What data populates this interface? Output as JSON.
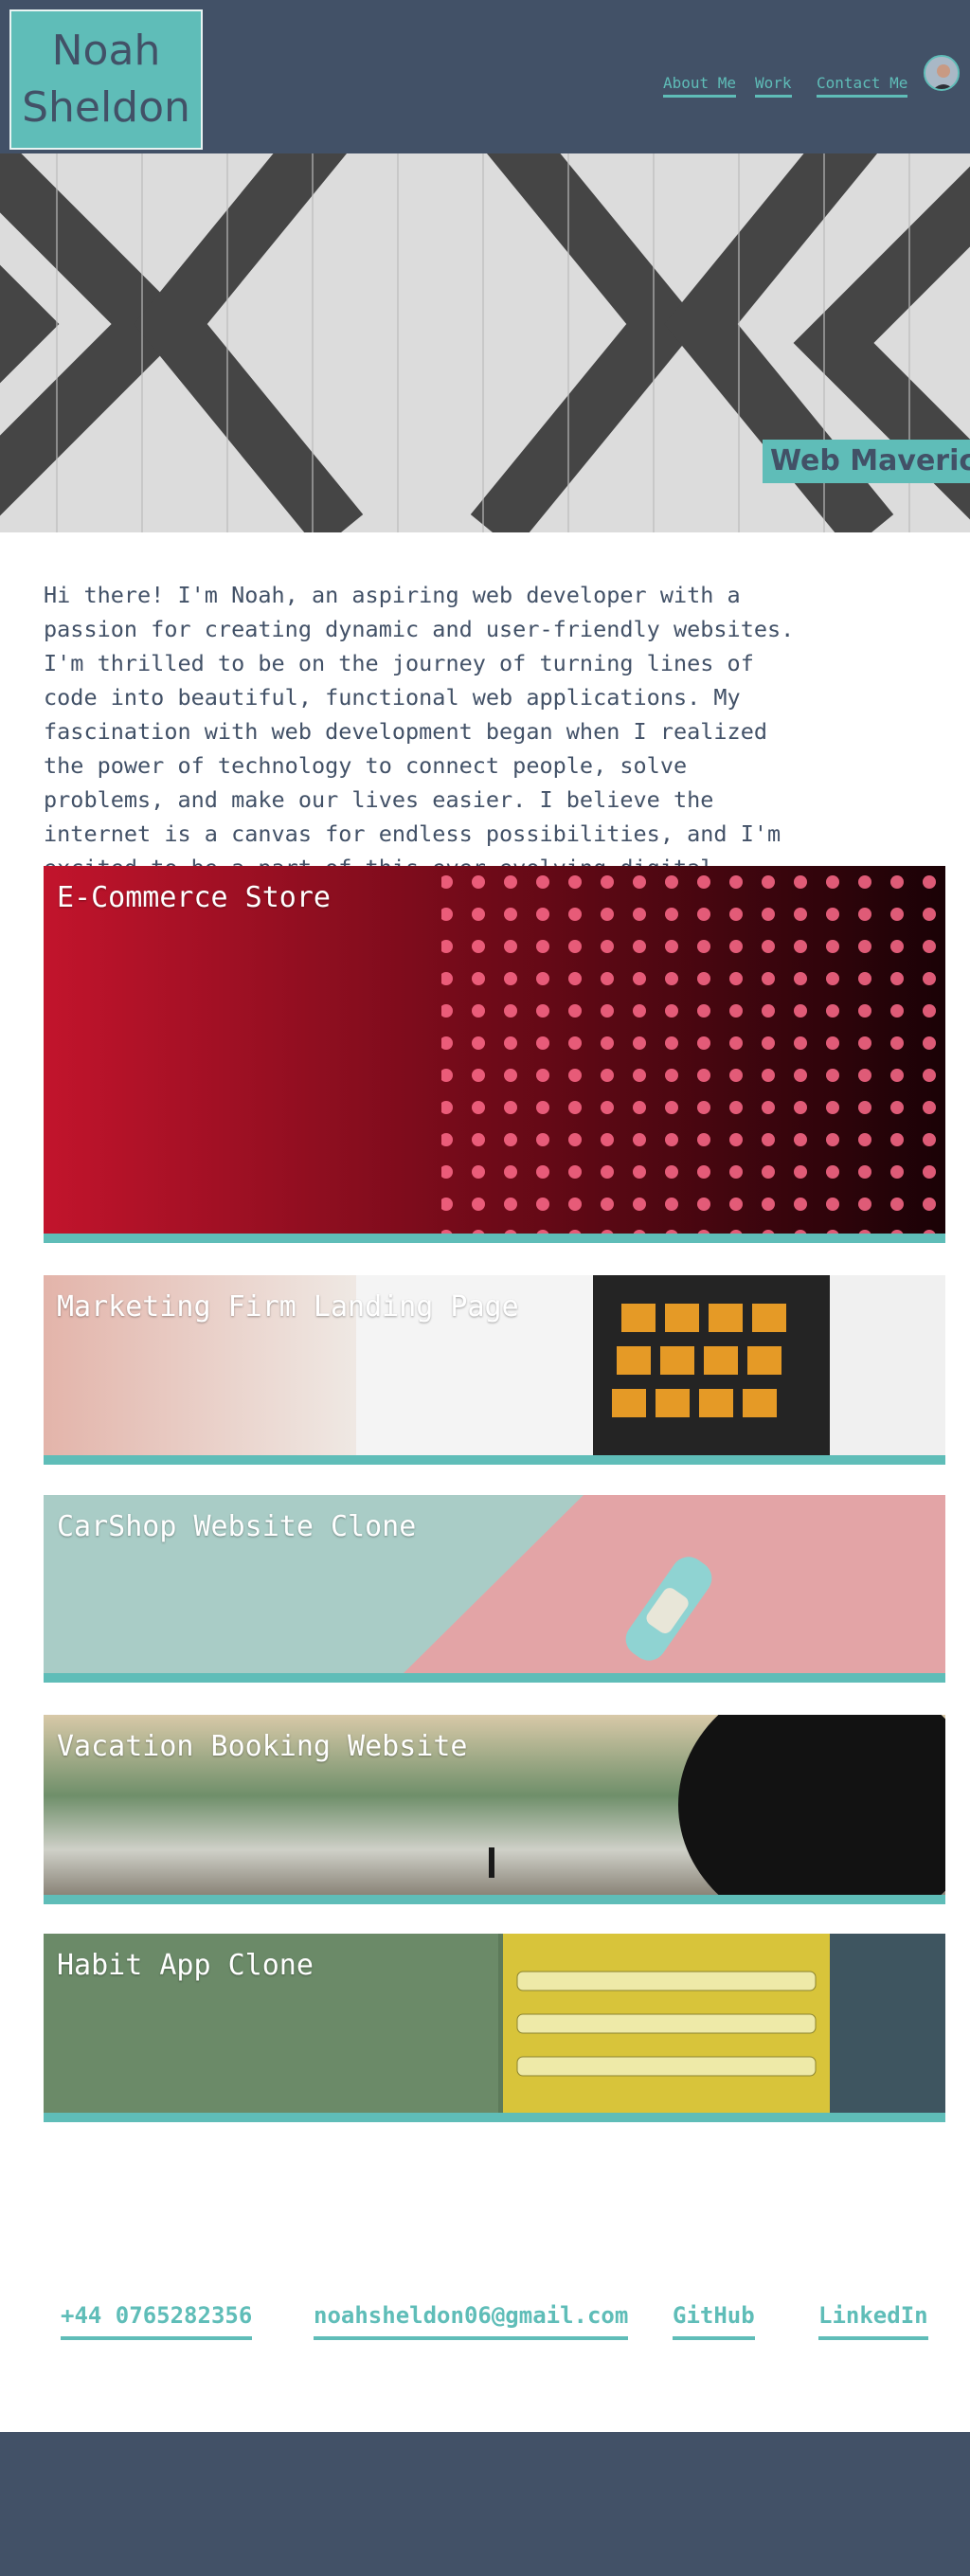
{
  "header": {
    "logo_line1": "Noah",
    "logo_line2": "Sheldon",
    "nav": [
      "About Me",
      "Work",
      "Contact Me"
    ]
  },
  "hero": {
    "tagline": "Web Maverick!"
  },
  "intro": {
    "text": "Hi there! I'm Noah, an aspiring web developer with a passion for creating dynamic and user-friendly websites. I'm thrilled to be on the journey of turning lines of code into beautiful, functional web applications. My fascination with web development began when I realized the power of technology to connect people, solve problems, and make our lives easier. I believe the internet is a canvas for endless possibilities, and I'm excited to be a part of this ever-evolving digital landscape."
  },
  "projects": [
    {
      "title": "E-Commerce Store"
    },
    {
      "title": "Marketing Firm Landing Page"
    },
    {
      "title": "CarShop Website Clone"
    },
    {
      "title": "Vacation Booking Website"
    },
    {
      "title": "Habit App Clone"
    }
  ],
  "contact": {
    "phone": "+44 0765282356",
    "email": "noahsheldon06@gmail.com",
    "github": "GitHub",
    "linkedin": "LinkedIn"
  },
  "colors": {
    "navy": "#425167",
    "teal": "#5fbdb8",
    "white": "#ffffff"
  }
}
